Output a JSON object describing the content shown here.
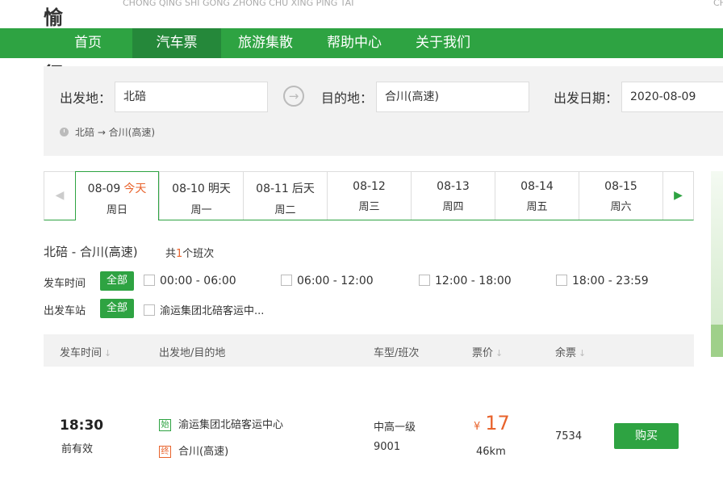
{
  "brand": {
    "logo": "愉客行",
    "pinyin": "CHONG QING SHI GONG ZHONG CHU XING PING TAI",
    "corner": "CH"
  },
  "nav": [
    "首页",
    "汽车票",
    "旅游集散",
    "帮助中心",
    "关于我们"
  ],
  "nav_active": "汽车票",
  "search": {
    "from_label": "出发地：",
    "from_value": "北碚",
    "to_label": "目的地：",
    "to_value": "合川(高速)",
    "date_label": "出发日期：",
    "date_value": "2020-08-09",
    "history": "北碚 → 合川(高速)"
  },
  "dates": [
    {
      "date": "08-09",
      "rel": "今天",
      "weekday": "周日",
      "active": true
    },
    {
      "date": "08-10",
      "rel": "明天",
      "weekday": "周一"
    },
    {
      "date": "08-11",
      "rel": "后天",
      "weekday": "周二"
    },
    {
      "date": "08-12",
      "rel": "",
      "weekday": "周三"
    },
    {
      "date": "08-13",
      "rel": "",
      "weekday": "周四"
    },
    {
      "date": "08-14",
      "rel": "",
      "weekday": "周五"
    },
    {
      "date": "08-15",
      "rel": "",
      "weekday": "周六"
    }
  ],
  "route": {
    "title": "北碚 - 合川(高速)",
    "count_prefix": "共",
    "count": "1",
    "count_suffix": "个班次"
  },
  "filters": {
    "time_label": "发车时间",
    "all_label": "全部",
    "times": [
      "00:00 - 06:00",
      "06:00 - 12:00",
      "12:00 - 18:00",
      "18:00 - 23:59"
    ],
    "station_label": "出发车站",
    "stations": [
      "渝运集团北碚客运中..."
    ]
  },
  "table": {
    "headers": {
      "time": "发车时间",
      "stations": "出发地/目的地",
      "bus": "车型/班次",
      "price": "票价",
      "remain": "余票"
    },
    "rows": [
      {
        "time": "18:30",
        "valid": "前有效",
        "start_tag": "始",
        "start": "渝运集团北碚客运中心",
        "end_tag": "终",
        "end": "合川(高速)",
        "bus_type": "中高一级",
        "bus_no": "9001",
        "currency": "¥",
        "price": "17",
        "distance": "46km",
        "remain": "7534",
        "buy": "购买"
      }
    ]
  },
  "colors": {
    "green": "#2ea342",
    "orange": "#e8632c"
  }
}
